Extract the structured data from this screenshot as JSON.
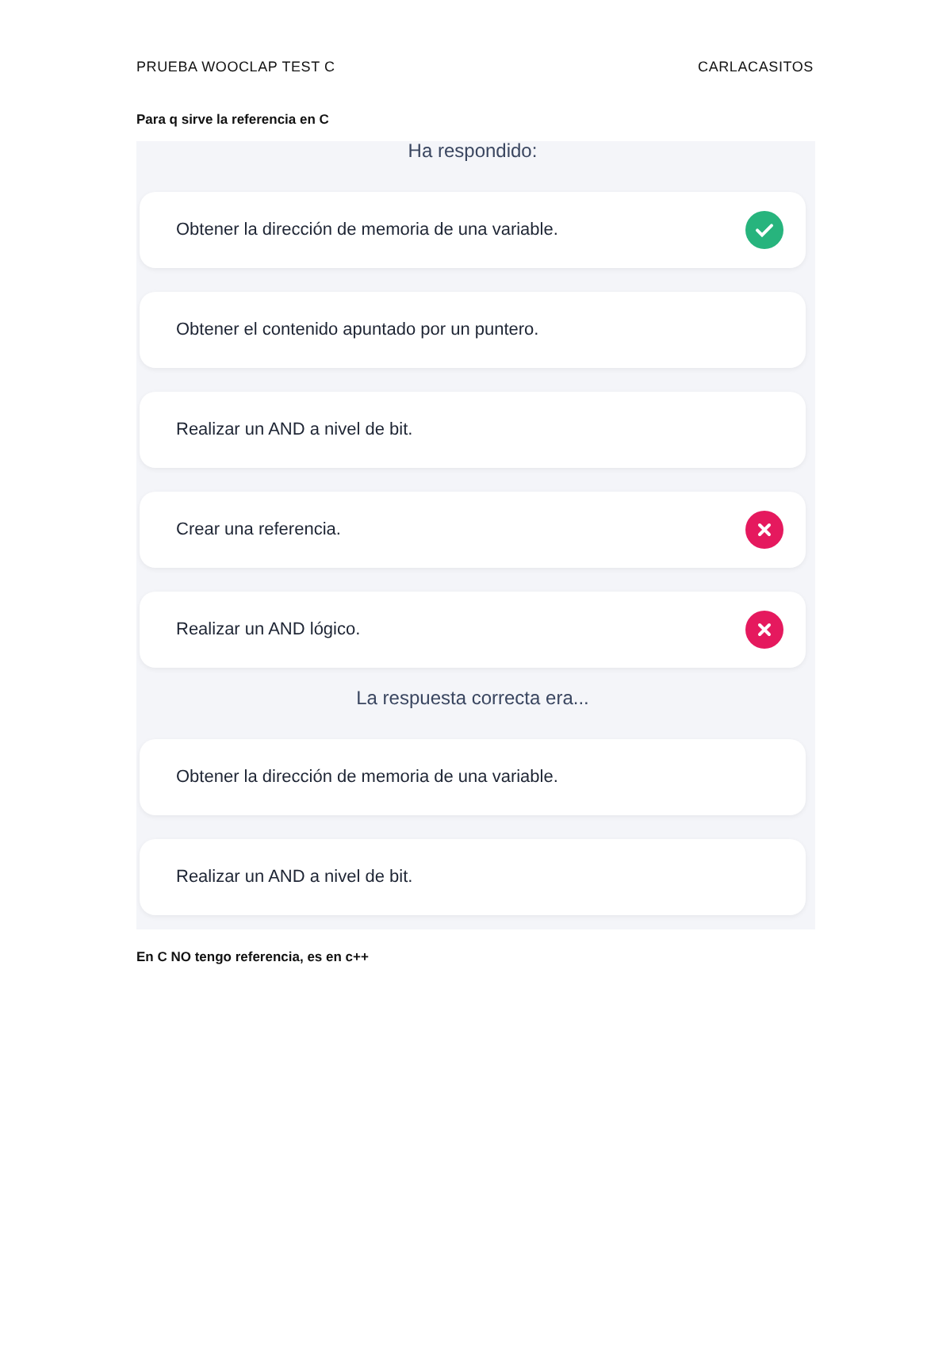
{
  "header": {
    "left": "PRUEBA WOOCLAP TEST C",
    "right": "CARLACASITOS"
  },
  "question": "Para q sirve la referencia en C",
  "screenshot": {
    "answered_heading": "Ha respondido:",
    "answers": [
      {
        "text": "Obtener la dirección de memoria de una variable.",
        "kind": "correct"
      },
      {
        "text": "Obtener el contenido apuntado por un puntero.",
        "kind": "plain"
      },
      {
        "text": "Realizar un AND a nivel de bit.",
        "kind": "plain"
      },
      {
        "text": "Crear una referencia.",
        "kind": "wrong"
      },
      {
        "text": "Realizar un AND lógico.",
        "kind": "wrong"
      }
    ],
    "correct_heading": "La respuesta correcta era...",
    "correct_answers": [
      {
        "text": "Obtener la dirección de memoria de una variable."
      },
      {
        "text": "Realizar un AND a nivel de bit."
      }
    ]
  },
  "note": "En C NO tengo referencia, es en c++"
}
